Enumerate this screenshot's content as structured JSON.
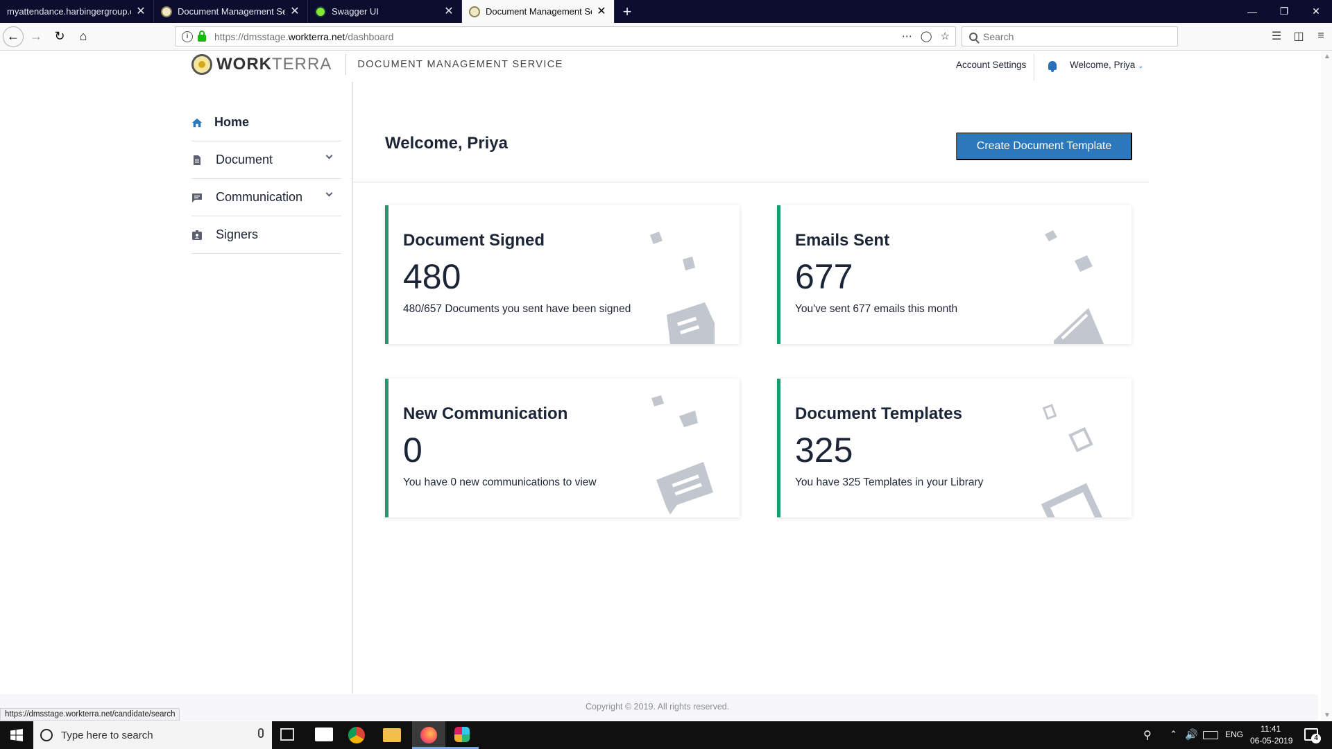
{
  "browser": {
    "tabs": [
      {
        "title": "myattendance.harbingergroup.com",
        "active": false,
        "favicon": "none"
      },
      {
        "title": "Document Management Servic",
        "active": false,
        "favicon": "dms-logo"
      },
      {
        "title": "Swagger UI",
        "active": false,
        "favicon": "swagger-logo"
      },
      {
        "title": "Document Management Servic",
        "active": true,
        "favicon": "dms-logo"
      }
    ],
    "new_tab_glyph": "+",
    "close_glyph": "✕",
    "url_prefix": "https://dmsstage.",
    "url_domain": "workterra.net",
    "url_path": "/dashboard",
    "search_placeholder": "Search",
    "status_url": "https://dmsstage.workterra.net/candidate/search"
  },
  "app": {
    "logo_bold": "WORK",
    "logo_light": "TERRA",
    "service_name": "DOCUMENT MANAGEMENT SERVICE",
    "account_settings": "Account Settings",
    "welcome_user": "Welcome, Priya",
    "accent_color": "#2b78bd",
    "card_accent": "#1e9a6e"
  },
  "sidebar": {
    "items": [
      {
        "label": "Home",
        "icon": "home-icon",
        "expandable": false
      },
      {
        "label": "Document",
        "icon": "document-icon",
        "expandable": true
      },
      {
        "label": "Communication",
        "icon": "chat-icon",
        "expandable": true
      },
      {
        "label": "Signers",
        "icon": "signer-badge-icon",
        "expandable": false
      }
    ]
  },
  "main": {
    "welcome": "Welcome, Priya",
    "create_button": "Create Document Template",
    "cards": [
      {
        "title": "Document Signed",
        "value": "480",
        "desc": "480/657 Documents you sent have been signed",
        "icon": "signed-document-icon"
      },
      {
        "title": "Emails Sent",
        "value": "677",
        "desc": "You've sent 677 emails this month",
        "icon": "envelope-icon"
      },
      {
        "title": "New Communication",
        "value": "0",
        "desc": "You have 0 new communications to view",
        "icon": "message-icon"
      },
      {
        "title": "Document Templates",
        "value": "325",
        "desc": "You have 325 Templates in your Library",
        "icon": "template-icon"
      }
    ],
    "footer": "Copyright © 2019. All rights reserved."
  },
  "taskbar": {
    "search_placeholder": "Type here to search",
    "language": "ENG",
    "time": "11:41",
    "date": "06-05-2019",
    "notification_count": "4"
  }
}
